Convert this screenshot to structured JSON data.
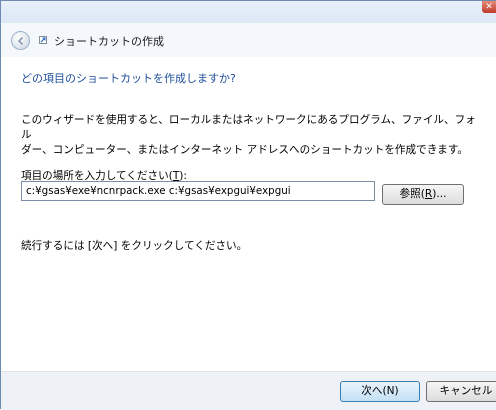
{
  "window": {
    "close_label": "✕"
  },
  "header": {
    "title": "ショートカットの作成"
  },
  "main": {
    "question": "どの項目のショートカットを作成しますか?",
    "description_line1": "このウィザードを使用すると、ローカルまたはネットワークにあるプログラム、ファイル、フォル",
    "description_line2": "ダー、コンピューター、またはインターネット アドレスへのショートカットを作成できます。",
    "location_label_prefix": "項目の場所を入力してください(",
    "location_label_key": "T",
    "location_label_suffix": "):",
    "location_value": "c:¥gsas¥exe¥ncnrpack.exe c:¥gsas¥expgui¥expgui",
    "browse_prefix": "参照(",
    "browse_key": "R",
    "browse_suffix": ")...",
    "instruction": "続行するには [次へ] をクリックしてください。"
  },
  "footer": {
    "next_label": "次へ(N)",
    "cancel_label": "キャンセル"
  },
  "icons": {
    "back": "back-arrow-icon",
    "wizard": "shortcut-wizard-icon",
    "close": "close-icon"
  },
  "colors": {
    "question_text": "#1f4e9a",
    "header_bg": "#f4f8fd",
    "footer_bg": "#eef1f5",
    "close_button": "#c0392b"
  }
}
